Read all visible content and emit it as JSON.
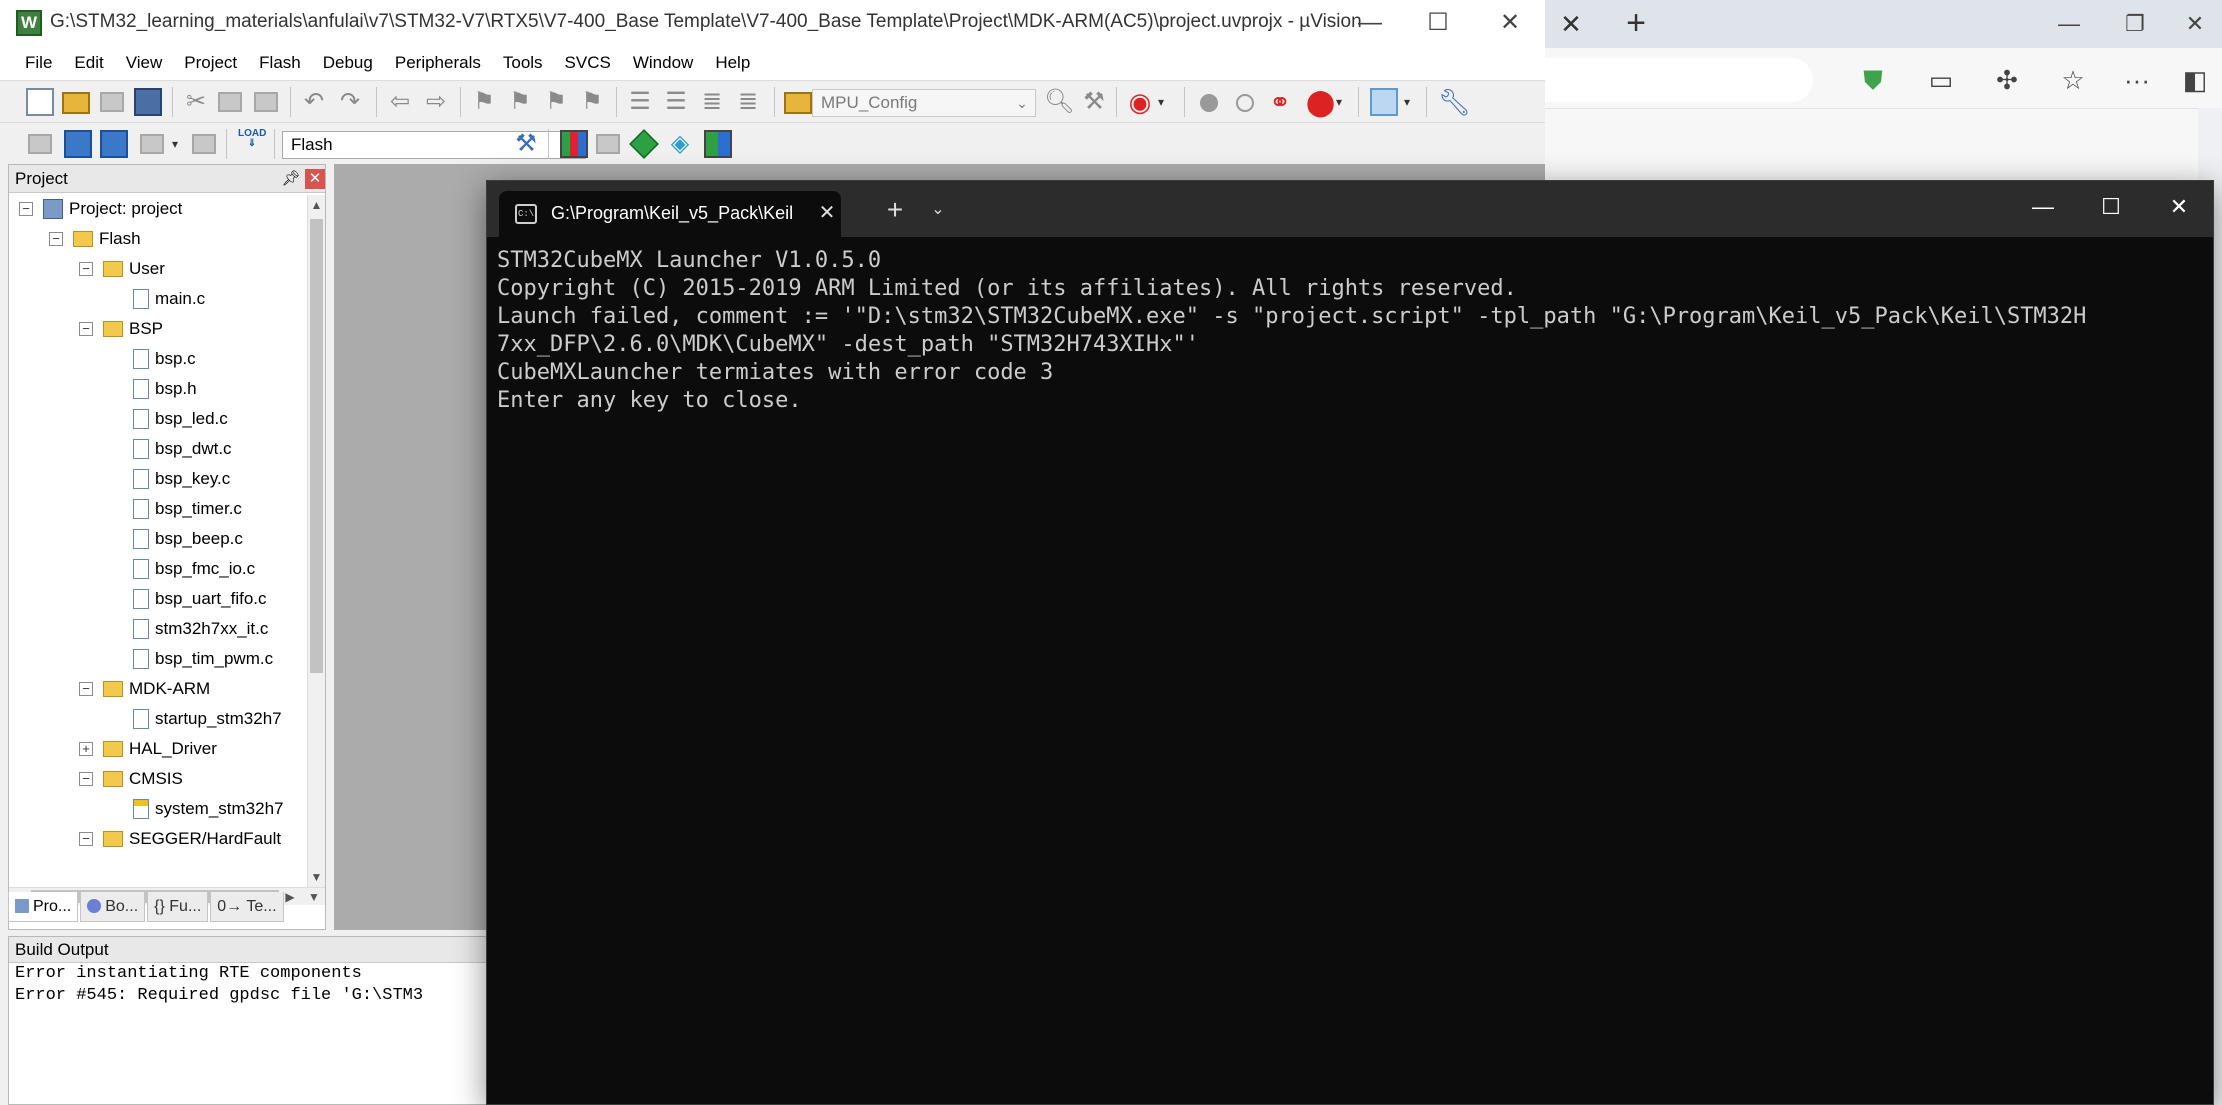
{
  "edge": {
    "tab_close": "✕",
    "new_tab": "+",
    "window_controls": [
      "—",
      "❐",
      "✕"
    ],
    "toolbar_icons": [
      "shield-check-icon",
      "document-icon",
      "extensions-icon",
      "favorites-icon",
      "more-icon",
      "sidebar-icon"
    ],
    "more_glyph": "···"
  },
  "uvision": {
    "title": "G:\\STM32_learning_materials\\anfulai\\v7\\STM32-V7\\RTX5\\V7-400_Base Template\\V7-400_Base Template\\Project\\MDK-ARM(AC5)\\project.uvprojx - µVision",
    "app_icon_letter": "W",
    "window_controls": [
      "—",
      "☐",
      "✕"
    ],
    "menu": [
      "File",
      "Edit",
      "View",
      "Project",
      "Flash",
      "Debug",
      "Peripherals",
      "Tools",
      "SVCS",
      "Window",
      "Help"
    ],
    "toolbar1": {
      "config_combo": "MPU_Config"
    },
    "toolbar2": {
      "target_combo": "Flash",
      "load_label": "LOAD"
    },
    "project_panel": {
      "title": "Project",
      "tree": [
        {
          "level": 0,
          "label": "Project: project",
          "icon": "project-icon",
          "expander": "−"
        },
        {
          "level": 1,
          "label": "Flash",
          "icon": "folder-icon",
          "expander": "−"
        },
        {
          "level": 2,
          "label": "User",
          "icon": "folder-icon",
          "expander": "−"
        },
        {
          "level": 3,
          "label": "main.c",
          "icon": "c-file-icon"
        },
        {
          "level": 2,
          "label": "BSP",
          "icon": "folder-icon",
          "expander": "−"
        },
        {
          "level": 3,
          "label": "bsp.c",
          "icon": "c-file-icon"
        },
        {
          "level": 3,
          "label": "bsp.h",
          "icon": "h-file-icon"
        },
        {
          "level": 3,
          "label": "bsp_led.c",
          "icon": "c-file-icon"
        },
        {
          "level": 3,
          "label": "bsp_dwt.c",
          "icon": "c-file-icon"
        },
        {
          "level": 3,
          "label": "bsp_key.c",
          "icon": "c-file-icon"
        },
        {
          "level": 3,
          "label": "bsp_timer.c",
          "icon": "c-file-icon"
        },
        {
          "level": 3,
          "label": "bsp_beep.c",
          "icon": "c-file-icon"
        },
        {
          "level": 3,
          "label": "bsp_fmc_io.c",
          "icon": "c-file-icon"
        },
        {
          "level": 3,
          "label": "bsp_uart_fifo.c",
          "icon": "c-file-icon"
        },
        {
          "level": 3,
          "label": "stm32h7xx_it.c",
          "icon": "c-file-icon"
        },
        {
          "level": 3,
          "label": "bsp_tim_pwm.c",
          "icon": "c-file-icon"
        },
        {
          "level": 2,
          "label": "MDK-ARM",
          "icon": "folder-icon",
          "expander": "−"
        },
        {
          "level": 3,
          "label": "startup_stm32h7",
          "icon": "asm-file-icon"
        },
        {
          "level": 2,
          "label": "HAL_Driver",
          "icon": "folder-icon",
          "expander": "+"
        },
        {
          "level": 2,
          "label": "CMSIS",
          "icon": "folder-icon",
          "expander": "−"
        },
        {
          "level": 3,
          "label": "system_stm32h7",
          "icon": "locked-file-icon"
        },
        {
          "level": 2,
          "label": "SEGGER/HardFault",
          "icon": "folder-icon",
          "expander": "−"
        }
      ],
      "tabs": [
        "Pro...",
        "Bo...",
        "{} Fu...",
        "0→ Te..."
      ]
    },
    "build_output": {
      "title": "Build Output",
      "lines": [
        "Error instantiating RTE components",
        "Error #545: Required gpdsc file 'G:\\STM3"
      ]
    }
  },
  "terminal": {
    "tab_title": "G:\\Program\\Keil_v5_Pack\\Keil",
    "tab_close": "✕",
    "new_tab": "+",
    "dropdown": "⌄",
    "window_controls": [
      "—",
      "☐",
      "✕"
    ],
    "lines": [
      "STM32CubeMX Launcher V1.0.5.0",
      "Copyright (C) 2015-2019 ARM Limited (or its affiliates). All rights reserved.",
      "",
      "",
      "Launch failed, comment := '\"D:\\stm32\\STM32CubeMX.exe\" -s \"project.script\" -tpl_path \"G:\\Program\\Keil_v5_Pack\\Keil\\STM32H",
      "7xx_DFP\\2.6.0\\MDK\\CubeMX\" -dest_path \"STM32H743XIHx\"'",
      "",
      "CubeMXLauncher termiates with error code 3",
      "Enter any key to close."
    ]
  }
}
